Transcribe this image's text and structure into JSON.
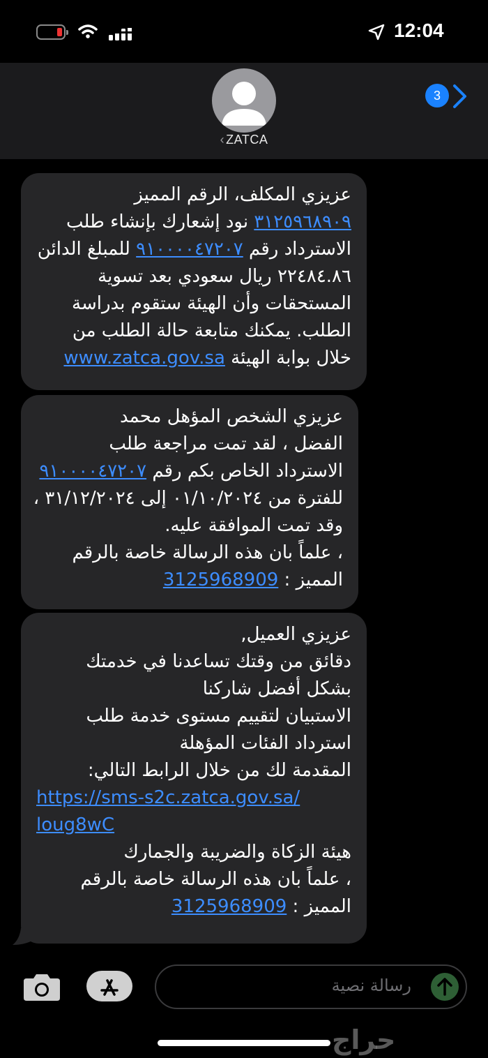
{
  "status_bar": {
    "time": "12:04",
    "battery_color": "#e33333"
  },
  "header": {
    "contact_name": "ZATCA",
    "back_chevron": "‹",
    "unread_count": "3"
  },
  "messages": [
    {
      "lines": [
        [
          {
            "t": "عزيزي المكلف، الرقم المميز"
          }
        ],
        [
          {
            "t": "٣١٢٥٩٦٨٩٠٩",
            "link": true
          },
          {
            "t": " نود إشعارك بإنشاء طلب"
          }
        ],
        [
          {
            "t": "الاسترداد رقم "
          },
          {
            "t": "٩١٠٠٠٠٤٧٢٠٧",
            "link": true
          },
          {
            "t": " للمبلغ الدائن"
          }
        ],
        [
          {
            "t": "٢٢٤٨٤.٨٦ ريال سعودي بعد تسوية"
          }
        ],
        [
          {
            "t": "المستحقات وأن الهيئة ستقوم بدراسة"
          }
        ],
        [
          {
            "t": "الطلب. يمكنك متابعة حالة الطلب من"
          }
        ],
        [
          {
            "t": "خلال بوابة الهيئة "
          },
          {
            "t": "www.zatca.gov.sa",
            "link": true
          }
        ]
      ]
    },
    {
      "lines": [
        [
          {
            "t": "عزيزي الشخص المؤهل محمد"
          }
        ],
        [
          {
            "t": "الفضل ، لقد تمت مراجعة طلب"
          }
        ],
        [
          {
            "t": "الاسترداد الخاص بكم رقم "
          },
          {
            "t": "٩١٠٠٠٠٤٧٢٠٧",
            "link": true
          }
        ],
        [
          {
            "t": "للفترة من ٠١/١٠/٢٠٢٤ إلى ٣١/١٢/٢٠٢٤ ،"
          }
        ],
        [
          {
            "t": "وقد تمت الموافقة عليه."
          }
        ],
        [
          {
            "t": "، علماً بان هذه الرسالة خاصة بالرقم"
          }
        ],
        [
          {
            "t": "المميز : "
          },
          {
            "t": "3125968909",
            "link": true
          }
        ]
      ]
    },
    {
      "lines": [
        [
          {
            "t": "عزيزي العميل,"
          }
        ],
        [
          {
            "t": " دقائق من وقتك تساعدنا في خدمتك"
          }
        ],
        [
          {
            "t": "بشكل أفضل شاركنا"
          }
        ],
        [
          {
            "t": "الاستبيان لتقييم مستوى خدمة طلب"
          }
        ],
        [
          {
            "t": "استرداد الفئات المؤهلة"
          }
        ],
        [
          {
            "t": " المقدمة لك من خلال الرابط التالي:"
          }
        ],
        [
          {
            "t": "https://sms-s2c.zatca.gov.sa/",
            "link": true,
            "ltr": true
          }
        ],
        [
          {
            "t": "loug8wC",
            "link": true,
            "ltr": true
          }
        ],
        [
          {
            "t": " هيئة الزكاة والضريبة والجمارك"
          }
        ],
        [
          {
            "t": "، علماً بان هذه الرسالة خاصة بالرقم"
          }
        ],
        [
          {
            "t": "المميز : "
          },
          {
            "t": "3125968909",
            "link": true
          }
        ]
      ]
    }
  ],
  "composer": {
    "placeholder": "رسالة نصية"
  },
  "watermark": "حراج",
  "colors": {
    "bubble": "#262628",
    "link": "#3d8dff",
    "badge": "#1a82ff",
    "send": "#2e5f35"
  }
}
